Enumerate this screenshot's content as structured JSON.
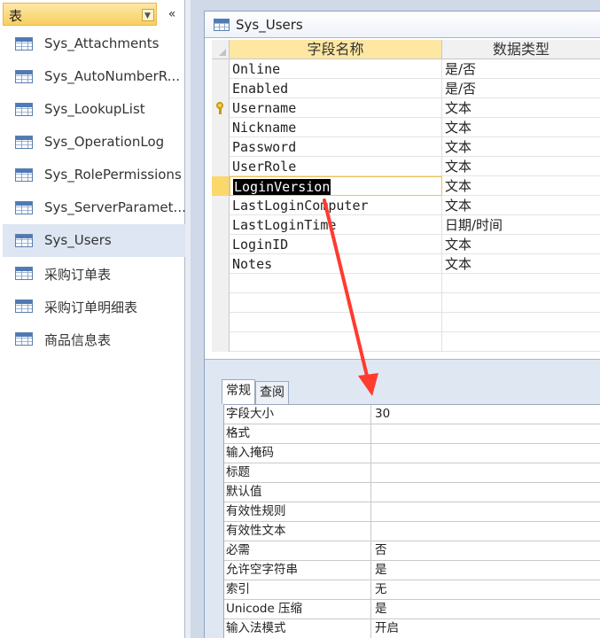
{
  "nav": {
    "title": "表",
    "items": [
      {
        "label": "Sys_Attachments"
      },
      {
        "label": "Sys_AutoNumberR..."
      },
      {
        "label": "Sys_LookupList"
      },
      {
        "label": "Sys_OperationLog"
      },
      {
        "label": "Sys_RolePermissions"
      },
      {
        "label": "Sys_ServerParamet..."
      },
      {
        "label": "Sys_Users",
        "selected": true
      },
      {
        "label": "采购订单表"
      },
      {
        "label": "采购订单明细表"
      },
      {
        "label": "商品信息表"
      }
    ],
    "dropdown_icon": "chevron-down-icon",
    "collapse_icon": "double-chevron-left-icon",
    "collapse_glyph": "«",
    "dropdown_glyph": "▼"
  },
  "document": {
    "tab_title": "Sys_Users",
    "columns": {
      "name": "字段名称",
      "type": "数据类型"
    },
    "fields": [
      {
        "name": "Online",
        "type": "是/否"
      },
      {
        "name": "Enabled",
        "type": "是/否"
      },
      {
        "name": "Username",
        "type": "文本",
        "primary_key": true
      },
      {
        "name": "Nickname",
        "type": "文本"
      },
      {
        "name": "Password",
        "type": "文本"
      },
      {
        "name": "UserRole",
        "type": "文本"
      },
      {
        "name": "LoginVersion",
        "type": "文本",
        "current": true
      },
      {
        "name": "LastLoginComputer",
        "type": "文本"
      },
      {
        "name": "LastLoginTime",
        "type": "日期/时间"
      },
      {
        "name": "LoginID",
        "type": "文本"
      },
      {
        "name": "Notes",
        "type": "文本"
      },
      {
        "name": "",
        "type": ""
      },
      {
        "name": "",
        "type": ""
      },
      {
        "name": "",
        "type": ""
      },
      {
        "name": "",
        "type": ""
      }
    ]
  },
  "properties": {
    "tabs": {
      "general": "常规",
      "lookup": "查阅"
    },
    "rows": [
      {
        "label": "字段大小",
        "value": "30"
      },
      {
        "label": "格式",
        "value": ""
      },
      {
        "label": "输入掩码",
        "value": ""
      },
      {
        "label": "标题",
        "value": ""
      },
      {
        "label": "默认值",
        "value": ""
      },
      {
        "label": "有效性规则",
        "value": ""
      },
      {
        "label": "有效性文本",
        "value": ""
      },
      {
        "label": "必需",
        "value": "否"
      },
      {
        "label": "允许空字符串",
        "value": "是"
      },
      {
        "label": "索引",
        "value": "无"
      },
      {
        "label": "Unicode 压缩",
        "value": "是"
      },
      {
        "label": "输入法模式",
        "value": "开启"
      }
    ]
  },
  "colors": {
    "selection": "#fde7a3",
    "annotation_arrow": "#ff3b2f",
    "workspace_bg": "#cfd9e7"
  }
}
